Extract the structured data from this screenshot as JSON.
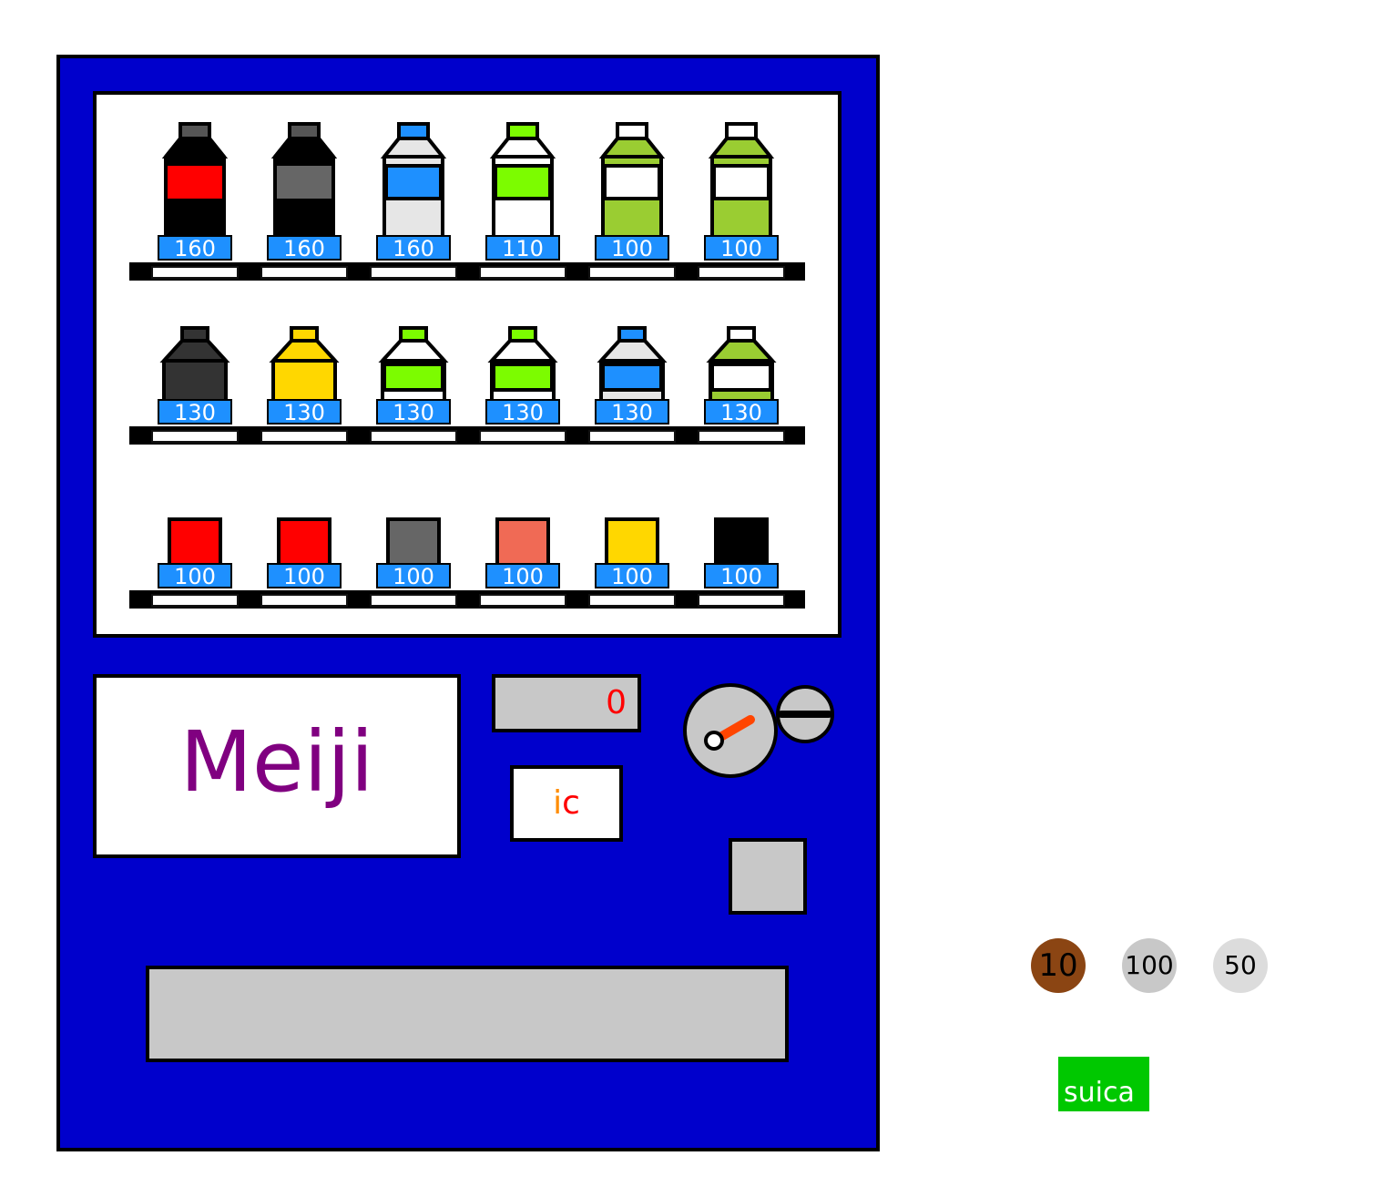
{
  "brand": "Meiji",
  "display_value": "0",
  "ic_reader": {
    "i": "i",
    "c": "c"
  },
  "rows": [
    {
      "items": [
        {
          "price": "160",
          "shape": "bottle",
          "body": "#000000",
          "label": "#ff0000",
          "cap": "#555555",
          "top": "#000000"
        },
        {
          "price": "160",
          "shape": "bottle",
          "body": "#000000",
          "label": "#666666",
          "cap": "#555555",
          "top": "#000000"
        },
        {
          "price": "160",
          "shape": "bottle",
          "body": "#e6e6e6",
          "label": "#1e90ff",
          "cap": "#1e90ff",
          "top": "#e6e6e6"
        },
        {
          "price": "110",
          "shape": "bottle",
          "body": "#ffffff",
          "label": "#7cfc00",
          "cap": "#7cfc00",
          "top": "#ffffff"
        },
        {
          "price": "100",
          "shape": "bottle",
          "body": "#9acd32",
          "label": "#ffffff",
          "cap": "#ffffff",
          "top": "#9acd32"
        },
        {
          "price": "100",
          "shape": "bottle",
          "body": "#9acd32",
          "label": "#ffffff",
          "cap": "#ffffff",
          "top": "#9acd32"
        }
      ]
    },
    {
      "items": [
        {
          "price": "130",
          "shape": "short",
          "body": "#333333",
          "label": "#333333",
          "cap": "#333333",
          "top": "#333333"
        },
        {
          "price": "130",
          "shape": "short",
          "body": "#ffd700",
          "label": "#ffd700",
          "cap": "#ffd700",
          "top": "#ffd700"
        },
        {
          "price": "130",
          "shape": "short",
          "body": "#ffffff",
          "label": "#7cfc00",
          "cap": "#7cfc00",
          "top": "#ffffff"
        },
        {
          "price": "130",
          "shape": "short",
          "body": "#ffffff",
          "label": "#7cfc00",
          "cap": "#7cfc00",
          "top": "#ffffff"
        },
        {
          "price": "130",
          "shape": "short",
          "body": "#e6e6e6",
          "label": "#1e90ff",
          "cap": "#1e90ff",
          "top": "#e6e6e6"
        },
        {
          "price": "130",
          "shape": "short",
          "body": "#9acd32",
          "label": "#ffffff",
          "cap": "#ffffff",
          "top": "#9acd32"
        }
      ]
    },
    {
      "items": [
        {
          "price": "100",
          "shape": "can",
          "body": "#ff0000"
        },
        {
          "price": "100",
          "shape": "can",
          "body": "#ff0000"
        },
        {
          "price": "100",
          "shape": "can",
          "body": "#666666"
        },
        {
          "price": "100",
          "shape": "can",
          "body": "#f06a55"
        },
        {
          "price": "100",
          "shape": "can",
          "body": "#ffd700"
        },
        {
          "price": "100",
          "shape": "can",
          "body": "#000000"
        }
      ]
    }
  ],
  "coins": [
    {
      "label": "10"
    },
    {
      "label": "100"
    },
    {
      "label": "50"
    }
  ],
  "suica_label": "suica"
}
